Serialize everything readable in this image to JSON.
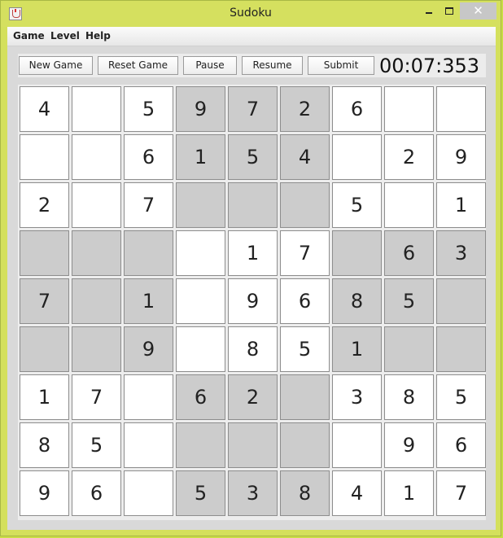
{
  "window": {
    "title": "Sudoku"
  },
  "menubar": {
    "items": [
      "Game",
      "Level",
      "Help"
    ]
  },
  "toolbar": {
    "buttons": [
      "New Game",
      "Reset Game",
      "Pause",
      "Resume",
      "Submit"
    ],
    "timer": "00:07:353"
  },
  "board": {
    "rows": [
      [
        "4",
        "",
        "5",
        "9",
        "7",
        "2",
        "6",
        "",
        ""
      ],
      [
        "",
        "",
        "6",
        "1",
        "5",
        "4",
        "",
        "2",
        "9"
      ],
      [
        "2",
        "",
        "7",
        "",
        "",
        "",
        "5",
        "",
        "1"
      ],
      [
        "",
        "",
        "",
        "",
        "1",
        "7",
        "",
        "6",
        "3"
      ],
      [
        "7",
        "",
        "1",
        "",
        "9",
        "6",
        "8",
        "5",
        ""
      ],
      [
        "",
        "",
        "9",
        "",
        "8",
        "5",
        "1",
        "",
        ""
      ],
      [
        "1",
        "7",
        "",
        "6",
        "2",
        "",
        "3",
        "8",
        "5"
      ],
      [
        "8",
        "5",
        "",
        "",
        "",
        "",
        "",
        "9",
        "6"
      ],
      [
        "9",
        "6",
        "",
        "5",
        "3",
        "8",
        "4",
        "1",
        "7"
      ]
    ],
    "shaded_boxes": [
      "top-middle",
      "middle-left",
      "middle-right",
      "bottom-middle"
    ],
    "colors": {
      "shaded": "#cccccc",
      "white": "#ffffff"
    }
  }
}
